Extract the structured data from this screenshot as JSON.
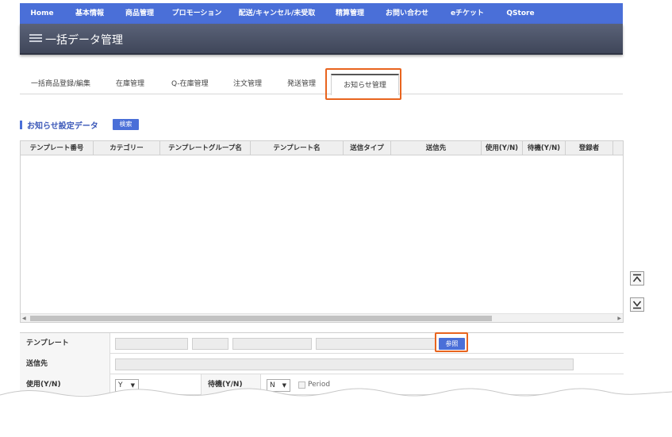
{
  "nav": {
    "items": [
      "Home",
      "基本情報",
      "商品管理",
      "プロモーション",
      "配送/キャンセル/未受取",
      "精算管理",
      "お問い合わせ",
      "eチケット",
      "QStore"
    ]
  },
  "header": {
    "title": "一括データ管理"
  },
  "tabs": {
    "items": [
      "一括商品登録/編集",
      "在庫管理",
      "Q-在庫管理",
      "注文管理",
      "発送管理",
      "お知らせ管理"
    ],
    "active": "お知らせ管理"
  },
  "section": {
    "title": "お知らせ設定データ",
    "search_label": "検索"
  },
  "grid": {
    "columns": [
      "テンプレート番号",
      "カテゴリー",
      "テンプレートグループ名",
      "テンプレート名",
      "送信タイプ",
      "送信先",
      "使用(Y/N)",
      "待機(Y/N)",
      "登録者"
    ],
    "rows": []
  },
  "form": {
    "template_label": "テンプレート",
    "ref_button": "参照",
    "send_to_label": "送信先",
    "use_label": "使用(Y/N)",
    "use_value": "Y",
    "wait_label": "待機(Y/N)",
    "wait_value": "N",
    "period_label": "Period"
  },
  "colors": {
    "nav_bg": "#4a6fd8",
    "header_bg": "#4a5164",
    "highlight": "#e8641e",
    "button": "#4a6fd8"
  },
  "icons": [
    "hamburger-icon",
    "scroll-top-icon",
    "scroll-bottom-icon",
    "caret-down-icon"
  ]
}
